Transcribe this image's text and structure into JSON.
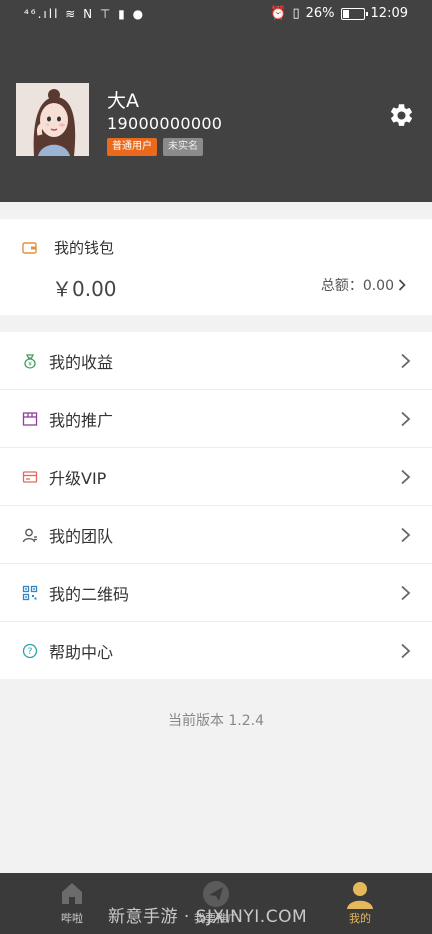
{
  "status_bar": {
    "left": "⁴⁶.ıll ≋ N ⊤ ▮ ●",
    "battery_percent": "26%",
    "time": "12:09"
  },
  "profile": {
    "name": "大A",
    "phone": "19000000000",
    "tags": {
      "user_type": "普通用户",
      "verification": "未实名"
    }
  },
  "wallet": {
    "title": "我的钱包",
    "amount": "￥0.00",
    "total_label": "总额：0.00"
  },
  "menu": [
    {
      "label": "我的收益",
      "icon": "money-bag-icon",
      "color": "#3aa05a"
    },
    {
      "label": "我的推广",
      "icon": "promotion-icon",
      "color": "#8e3f9b"
    },
    {
      "label": "升级VIP",
      "icon": "card-icon",
      "color": "#e06a5a"
    },
    {
      "label": "我的团队",
      "icon": "team-icon",
      "color": "#555555"
    },
    {
      "label": "我的二维码",
      "icon": "qrcode-icon",
      "color": "#2e86c8"
    },
    {
      "label": "帮助中心",
      "icon": "help-icon",
      "color": "#2aa3a8"
    }
  ],
  "version_text": "当前版本 1.2.4",
  "tabbar": {
    "tabs": [
      {
        "label": "哔啦",
        "icon": "home-icon",
        "active": false
      },
      {
        "label": "我要推广",
        "icon": "send-icon",
        "active": false
      },
      {
        "label": "我的",
        "icon": "user-icon",
        "active": true
      }
    ],
    "active_color": "#e6b85c"
  },
  "watermark": "新意手游 · SJXINYI.COM"
}
